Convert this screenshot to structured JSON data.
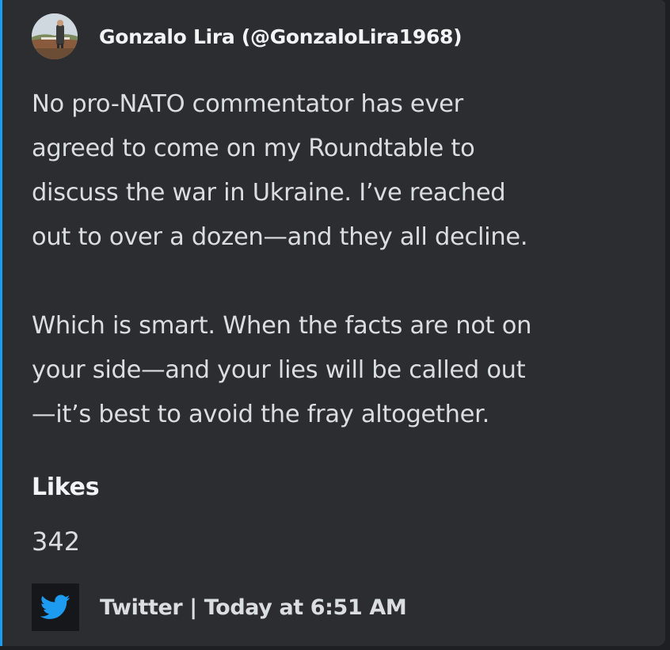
{
  "embed": {
    "accent_color": "#1d9bf0",
    "author": {
      "name": "Gonzalo Lira (@GonzaloLira1968)",
      "avatar_icon": "profile-photo"
    },
    "description": {
      "paragraphs": [
        "No pro-NATO commentator has ever\nagreed to come on my Roundtable to\ndiscuss the war in Ukraine. I’ve reached\nout to over a dozen—and they all decline.",
        "Which is smart. When the facts are not on\nyour side—and your lies will be called out\n—it’s best to avoid the fray altogether."
      ]
    },
    "fields": [
      {
        "name": "Likes",
        "value": "342"
      }
    ],
    "footer": {
      "icon": "twitter-bird-icon",
      "text": "Twitter | Today at 6:51 AM"
    }
  }
}
